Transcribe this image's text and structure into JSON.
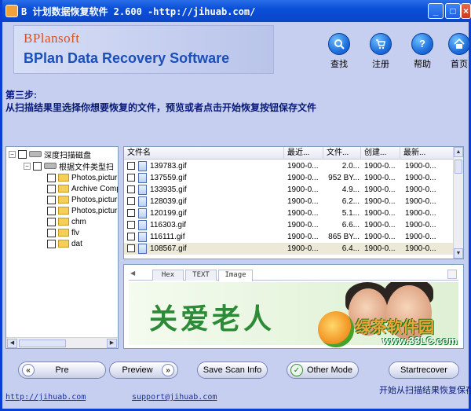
{
  "window": {
    "title": "B 计划数据恢复软件   2.600 -http://jihuab.com/",
    "controls": {
      "minimize": "_",
      "maximize": "□",
      "close": "×"
    }
  },
  "branding": {
    "logo_top": "BPlansoft",
    "logo_bottom": "BPlan Data Recovery Software"
  },
  "nav": [
    {
      "label": "查找",
      "icon": "search-icon"
    },
    {
      "label": "注册",
      "icon": "cart-icon"
    },
    {
      "label": "帮助",
      "icon": "help-icon"
    },
    {
      "label": "首页",
      "icon": "home-icon"
    }
  ],
  "step": {
    "title": "第三步:",
    "description": "从扫描结果里选择你想要恢复的文件，预览或者点击开始恢复按钮保存文件"
  },
  "tree": {
    "root": "深度扫描磁盘",
    "child": "根据文件类型扫",
    "items": [
      "Photos,pictur",
      "Archive Comp",
      "Photos,pictur",
      "Photos,pictur",
      "chm",
      "flv",
      "dat"
    ]
  },
  "file_list": {
    "columns": [
      "文件名",
      "最近...",
      "文件...",
      "创建...",
      "最新..."
    ],
    "rows": [
      {
        "name": "139783.gif",
        "recent": "1900-0...",
        "size": "2.0...",
        "created": "1900-0...",
        "modified": "1900-0...",
        "selected": false
      },
      {
        "name": "137559.gif",
        "recent": "1900-0...",
        "size": "952 BY...",
        "created": "1900-0...",
        "modified": "1900-0...",
        "selected": false
      },
      {
        "name": "133935.gif",
        "recent": "1900-0...",
        "size": "4.9...",
        "created": "1900-0...",
        "modified": "1900-0...",
        "selected": false
      },
      {
        "name": "128039.gif",
        "recent": "1900-0...",
        "size": "6.2...",
        "created": "1900-0...",
        "modified": "1900-0...",
        "selected": false
      },
      {
        "name": "120199.gif",
        "recent": "1900-0...",
        "size": "5.1...",
        "created": "1900-0...",
        "modified": "1900-0...",
        "selected": false
      },
      {
        "name": "116303.gif",
        "recent": "1900-0...",
        "size": "6.6...",
        "created": "1900-0...",
        "modified": "1900-0...",
        "selected": false
      },
      {
        "name": "116111.gif",
        "recent": "1900-0...",
        "size": "865 BY...",
        "created": "1900-0...",
        "modified": "1900-0...",
        "selected": false
      },
      {
        "name": "108567.gif",
        "recent": "1900-0...",
        "size": "6.4...",
        "created": "1900-0...",
        "modified": "1900-0...",
        "selected": true
      }
    ]
  },
  "preview": {
    "tabs": [
      "Hex",
      "TEXT",
      "Image"
    ],
    "active_tab": "Image",
    "image_text": "关爱老人"
  },
  "watermark": {
    "main": "绿茶软件园",
    "sub": "www.33LC.com"
  },
  "buttons": {
    "pre": "Pre",
    "preview": "Preview",
    "save_scan": "Save Scan Info",
    "other_mode": "Other Mode",
    "startrecover": "Startrecover"
  },
  "status": "开始从扫描结果恢复保存",
  "footer": {
    "site": "http://jihuab.com",
    "email": "support@jihuab.com"
  },
  "colors": {
    "titlebar": "#0a4fd8",
    "window_bg": "#c7cff0",
    "accent_text": "#0a1a7a",
    "logo_orange": "#d7501f",
    "logo_blue": "#1a50b7",
    "selection": "#ece9d8"
  }
}
